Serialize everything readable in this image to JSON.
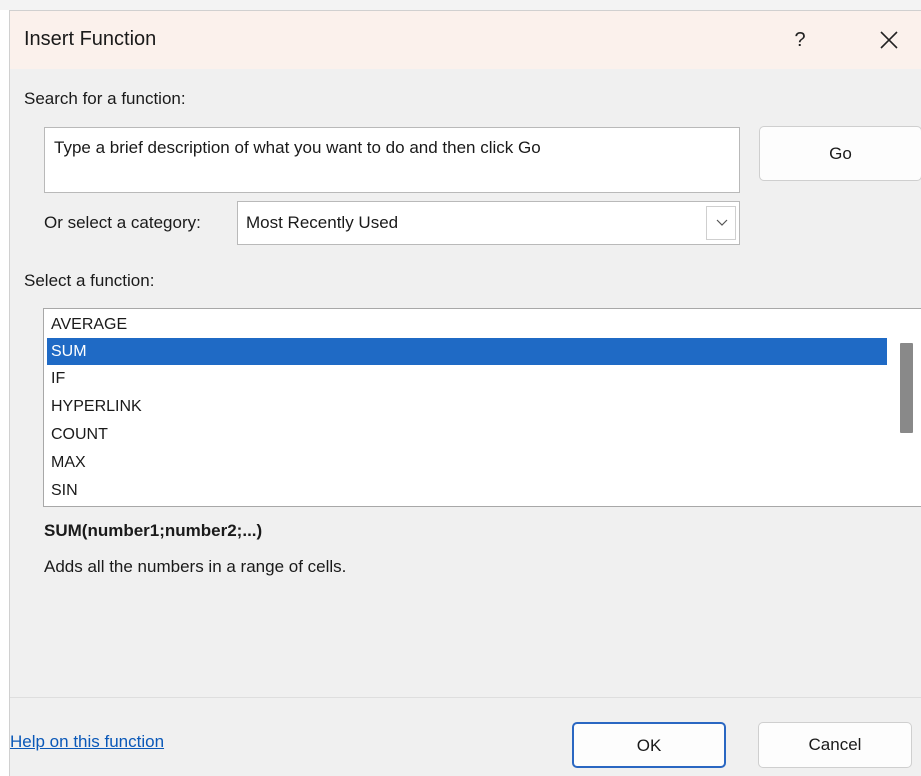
{
  "dialog": {
    "title": "Insert Function",
    "help_button": "?",
    "search_label": "Search for a function:",
    "search_placeholder": "Type a brief description of what you want to do and then click Go",
    "go_label": "Go",
    "category_label": "Or select a category:",
    "category_value": "Most Recently Used",
    "function_label": "Select a function:",
    "functions": [
      "AVERAGE",
      "SUM",
      "IF",
      "HYPERLINK",
      "COUNT",
      "MAX",
      "SIN"
    ],
    "selected_function": "SUM",
    "syntax": "SUM(number1;number2;...)",
    "description": "Adds all the numbers in a range of cells.",
    "help_link": "Help on this function",
    "ok_label": "OK",
    "cancel_label": "Cancel"
  },
  "colors": {
    "selection": "#1f6ac5",
    "link": "#0a58b8",
    "titlebar": "#fbf1ec",
    "dialog_bg": "#f0f0f0"
  }
}
